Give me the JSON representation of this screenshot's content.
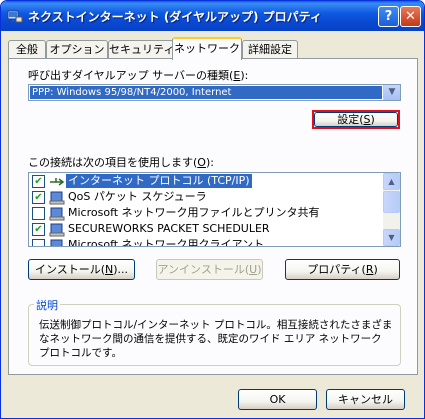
{
  "window": {
    "title": "ネクストインターネット (ダイヤルアップ) プロパティ",
    "help_label": "?",
    "close_label": "✕"
  },
  "tabs": [
    {
      "label": "全般"
    },
    {
      "label": "オプション"
    },
    {
      "label": "セキュリティ"
    },
    {
      "label": "ネットワーク"
    },
    {
      "label": "詳細設定"
    }
  ],
  "server_type": {
    "label_pre": "呼び出すダイヤルアップ サーバーの種類(",
    "label_key": "E",
    "label_post": "):",
    "selected": "PPP: Windows 95/98/NT4/2000, Internet"
  },
  "settings_button": {
    "pre": "設定(",
    "key": "S",
    "post": ")"
  },
  "components": {
    "label_pre": "この接続は次の項目を使用します(",
    "label_key": "O",
    "label_post": "):",
    "items": [
      {
        "label": "インターネット プロトコル (TCP/IP)",
        "checked": true,
        "selected": true
      },
      {
        "label": "QoS パケット スケジューラ",
        "checked": true,
        "selected": false
      },
      {
        "label": "Microsoft ネットワーク用ファイルとプリンタ共有",
        "checked": false,
        "selected": false
      },
      {
        "label": "SECUREWORKS PACKET SCHEDULER",
        "checked": true,
        "selected": false
      },
      {
        "label": "Microsoft ネットワーク用クライアント",
        "checked": false,
        "selected": false
      }
    ]
  },
  "actions": {
    "install": {
      "pre": "インストール(",
      "key": "N",
      "post": ")..."
    },
    "uninstall": {
      "pre": "アンインストール(",
      "key": "U",
      "post": ")"
    },
    "properties": {
      "pre": "プロパティ(",
      "key": "R",
      "post": ")"
    }
  },
  "description": {
    "title": "説明",
    "text": "伝送制御プロトコル/インターネット プロトコル。相互接続されたさまざまなネットワーク間の通信を提供する、既定のワイド エリア ネットワーク プロトコルです。"
  },
  "footer": {
    "ok": "OK",
    "cancel": "キャンセル"
  }
}
